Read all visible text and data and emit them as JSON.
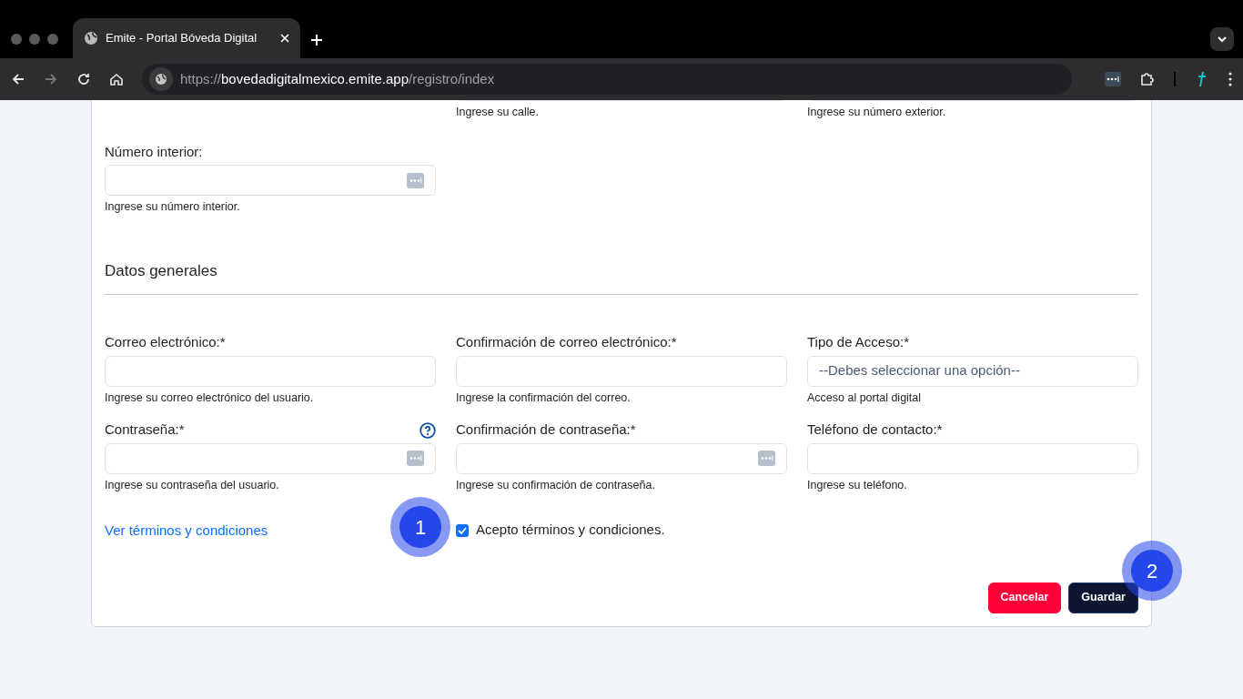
{
  "browser": {
    "tabs": [
      {
        "title": "Emite - Portal Bóveda Digital",
        "selected": true
      }
    ],
    "url": {
      "scheme": "https://",
      "host": "bovedadigitalmexico.emite.app",
      "path": "/registro/index"
    }
  },
  "form": {
    "rows": [
      [
        {
          "kind": "empty"
        },
        {
          "kind": "cut",
          "help": "Ingrese su calle."
        },
        {
          "kind": "cut",
          "help": "Ingrese su número exterior."
        }
      ],
      [
        {
          "kind": "secret",
          "label": "Número interior:",
          "help": "Ingrese su número interior."
        }
      ]
    ],
    "section_title": "Datos generales",
    "section_rows": [
      [
        {
          "kind": "text",
          "label": "Correo electrónico:*",
          "help": "Ingrese su correo electrónico del usuario."
        },
        {
          "kind": "text",
          "label": "Confirmación de correo electrónico:*",
          "help": "Ingrese la confirmación del correo."
        },
        {
          "kind": "select",
          "label": "Tipo de Acceso:*",
          "placeholder": "--Debes seleccionar una opción--",
          "help": "Acceso al portal digital"
        }
      ],
      [
        {
          "kind": "secret",
          "label": "Contraseña:*",
          "has_help_icon": true,
          "help": "Ingrese su contraseña del usuario."
        },
        {
          "kind": "secret",
          "label": "Confirmación de contraseña:*",
          "help": "Ingrese su confirmación de contraseña."
        },
        {
          "kind": "text",
          "label": "Teléfono de contacto:*",
          "help": "Ingrese su teléfono."
        }
      ]
    ],
    "terms_link": "Ver términos y condiciones",
    "accept": {
      "label": "Acepto términos y condiciones.",
      "checked": true
    },
    "buttons": [
      {
        "label": "Cancelar",
        "kind": "danger"
      },
      {
        "label": "Guardar",
        "kind": "primary"
      }
    ]
  },
  "annotations": [
    {
      "label": "1"
    },
    {
      "label": "2"
    }
  ]
}
